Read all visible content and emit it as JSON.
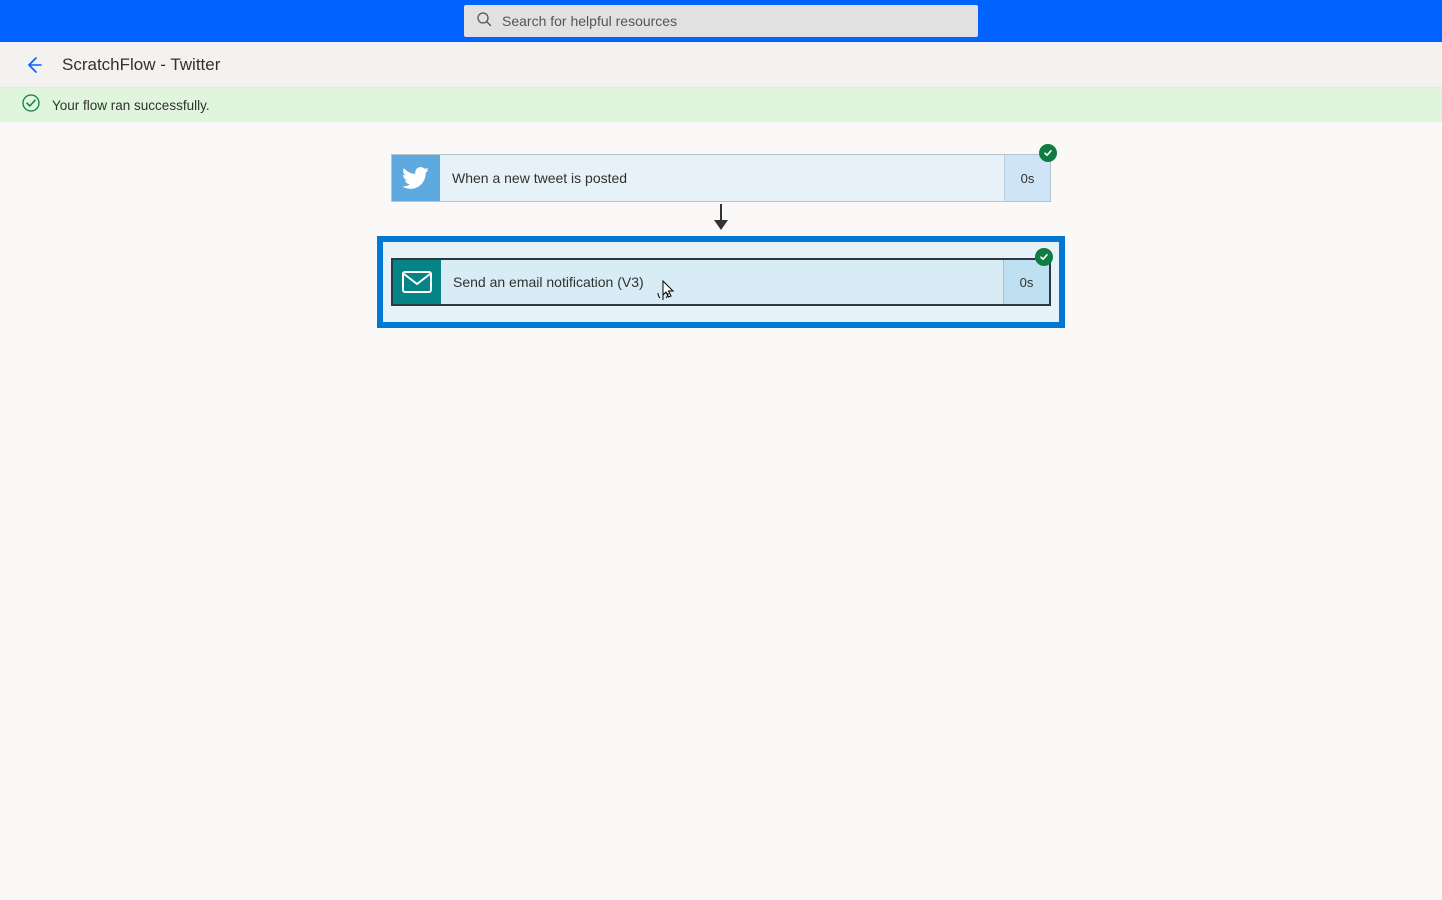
{
  "search": {
    "placeholder": "Search for helpful resources"
  },
  "breadcrumb": {
    "title": "ScratchFlow - Twitter"
  },
  "banner": {
    "message": "Your flow ran successfully."
  },
  "flow": {
    "trigger": {
      "label": "When a new tweet is posted",
      "duration": "0s",
      "icon": "twitter-icon"
    },
    "action": {
      "label": "Send an email notification (V3)",
      "duration": "0s",
      "icon": "mail-icon"
    }
  }
}
